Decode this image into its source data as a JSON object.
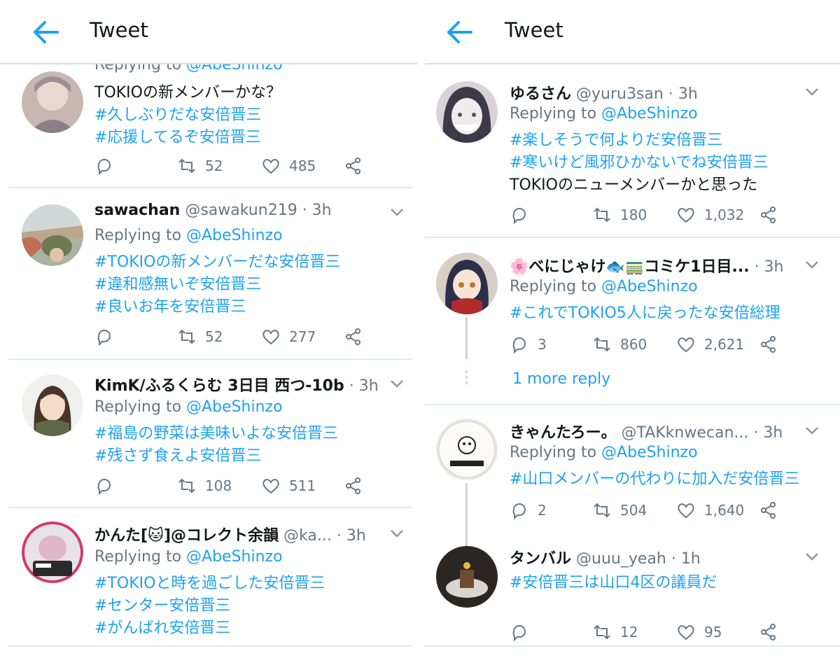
{
  "colors": {
    "accent": "#1da1f2",
    "secondary": "#657786",
    "text": "#14171a",
    "divider": "#e1e8ed"
  },
  "left": {
    "header": {
      "back_icon": "back-arrow-icon",
      "title": "Tweet"
    },
    "tweets": [
      {
        "reply_prefix": "Replying to",
        "mention": "@AbeShinzo",
        "lines": [
          "TOKIOの新メンバーかな？"
        ],
        "tags": [
          "#久しぶりだな安倍晋三",
          "#応援してるぞ安倍晋三"
        ],
        "retweets": "52",
        "likes": "485"
      },
      {
        "name": "sawachan",
        "handle": "@sawakun219",
        "time": "· 3h",
        "reply_prefix": "Replying to",
        "mention": "@AbeShinzo",
        "tags": [
          "#TOKIOの新メンバーだな安倍晋三",
          "#違和感無いぞ安倍晋三",
          "#良いお年を安倍晋三"
        ],
        "retweets": "52",
        "likes": "277"
      },
      {
        "name": "KimK/ふるくらむ 3日目 西つ-10b",
        "time": "· 3h",
        "reply_prefix": "Replying to",
        "mention": "@AbeShinzo",
        "tags": [
          "#福島の野菜は美味いよな安倍晋三",
          "#残さず食えよ安倍晋三"
        ],
        "retweets": "108",
        "likes": "511"
      },
      {
        "name": "かんた[🐱]@コレクト余韻",
        "handle": "@ka...",
        "time": "· 3h",
        "reply_prefix": "Replying to",
        "mention": "@AbeShinzo",
        "tags": [
          "#TOKIOと時を過ごした安倍晋三",
          "#センター安倍晋三",
          "#がんばれ安倍晋三"
        ]
      }
    ]
  },
  "right": {
    "header": {
      "back_icon": "back-arrow-icon",
      "title": "Tweet"
    },
    "tweets": [
      {
        "name": "ゆるさん",
        "handle": "@yuru3san",
        "time": "· 3h",
        "reply_prefix": "Replying to",
        "mention": "@AbeShinzo",
        "tags": [
          "#楽しそうで何よりだ安倍晋三",
          "#寒いけど風邪ひかないでね安倍晋三"
        ],
        "lines": [
          "TOKIOのニューメンバーかと思った"
        ],
        "retweets": "180",
        "likes": "1,032"
      },
      {
        "name": "🌸べにじゃけ🐟🚃コミケ1日目...",
        "time": "· 3h",
        "reply_prefix": "Replying to",
        "mention": "@AbeShinzo",
        "tags": [
          "#これでTOKIO5人に戻ったな安倍総理"
        ],
        "replies": "3",
        "retweets": "860",
        "likes": "2,621",
        "more_replies": "1 more reply"
      },
      {
        "name": "きゃんたろー。",
        "handle": "@TAKknwecan...",
        "time": "· 3h",
        "reply_prefix": "Replying to",
        "mention": "@AbeShinzo",
        "tags": [
          "#山口メンバーの代わりに加入だ安倍晋三"
        ],
        "replies": "2",
        "retweets": "504",
        "likes": "1,640"
      },
      {
        "name": "タンバル",
        "handle": "@uuu_yeah",
        "time": "· 1h",
        "tags": [
          "#安倍晋三は山口4区の議員だ"
        ],
        "retweets": "12",
        "likes": "95"
      }
    ]
  }
}
